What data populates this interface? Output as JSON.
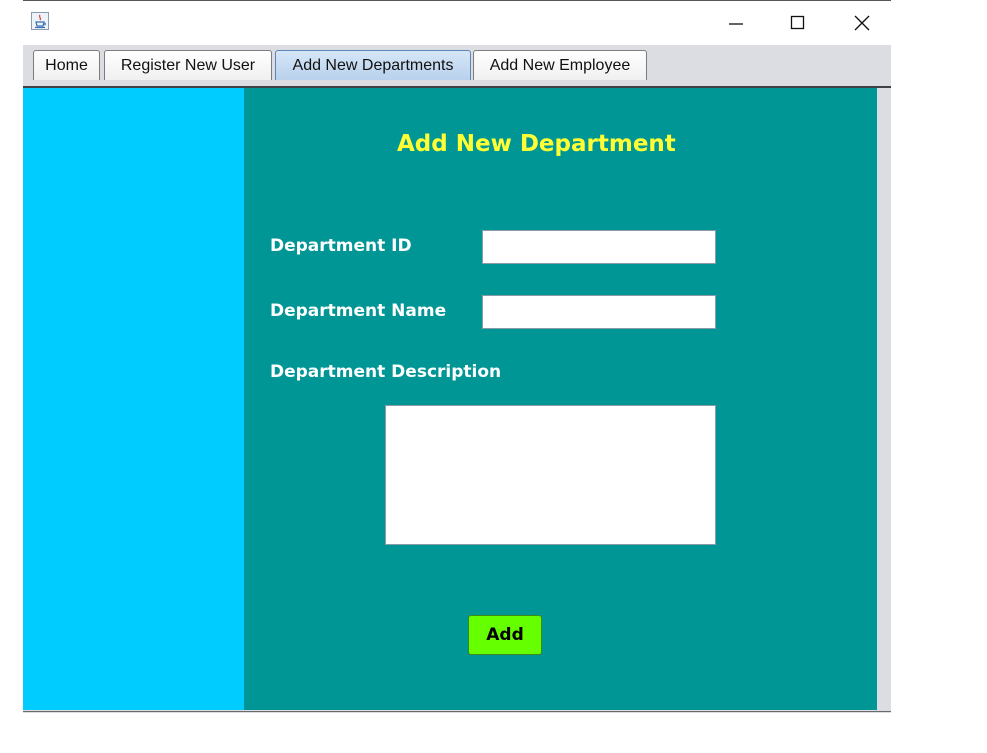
{
  "window": {
    "app_icon": "java-cup-icon",
    "controls": {
      "minimize_icon": "minimize-icon",
      "maximize_icon": "maximize-icon",
      "close_icon": "close-icon"
    }
  },
  "tabs": [
    {
      "label": "Home",
      "active": false
    },
    {
      "label": "Register New User",
      "active": false
    },
    {
      "label": "Add New Departments",
      "active": true
    },
    {
      "label": "Add New Employee",
      "active": false
    }
  ],
  "form": {
    "title": "Add New Department",
    "fields": {
      "department_id": {
        "label": "Department ID",
        "value": ""
      },
      "department_name": {
        "label": "Department Name",
        "value": ""
      },
      "department_description": {
        "label": "Department Description",
        "value": ""
      }
    },
    "add_button": "Add"
  },
  "colors": {
    "side_panel": "#00ccff",
    "main_panel": "#009696",
    "title_text": "#ffff33",
    "label_text": "#ffffff",
    "add_button": "#66ff00"
  }
}
